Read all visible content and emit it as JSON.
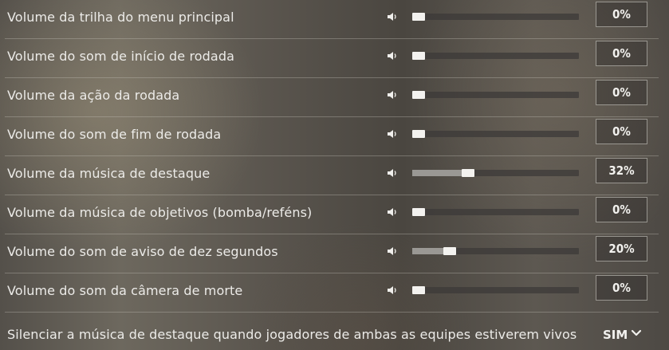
{
  "settings": {
    "volume_rows": [
      {
        "label": "Volume da trilha do menu principal",
        "value": "0%",
        "level": 0
      },
      {
        "label": "Volume do som de início de rodada",
        "value": "0%",
        "level": 0
      },
      {
        "label": "Volume da ação da rodada",
        "value": "0%",
        "level": 0
      },
      {
        "label": "Volume do som de fim de rodada",
        "value": "0%",
        "level": 0
      },
      {
        "label": "Volume da música de destaque",
        "value": "32%",
        "level": 0.32
      },
      {
        "label": "Volume da música de objetivos (bomba/reféns)",
        "value": "0%",
        "level": 0
      },
      {
        "label": "Volume do som de aviso de dez segundos",
        "value": "20%",
        "level": 0.2
      },
      {
        "label": "Volume do som da câmera de morte",
        "value": "0%",
        "level": 0
      }
    ],
    "toggle": {
      "label": "Silenciar a música de destaque quando jogadores de ambas as equipes estiverem vivos",
      "value": "SIM"
    }
  },
  "icons": {
    "row_icon": "speaker-icon",
    "dropdown_icon": "chevron-down-icon"
  }
}
